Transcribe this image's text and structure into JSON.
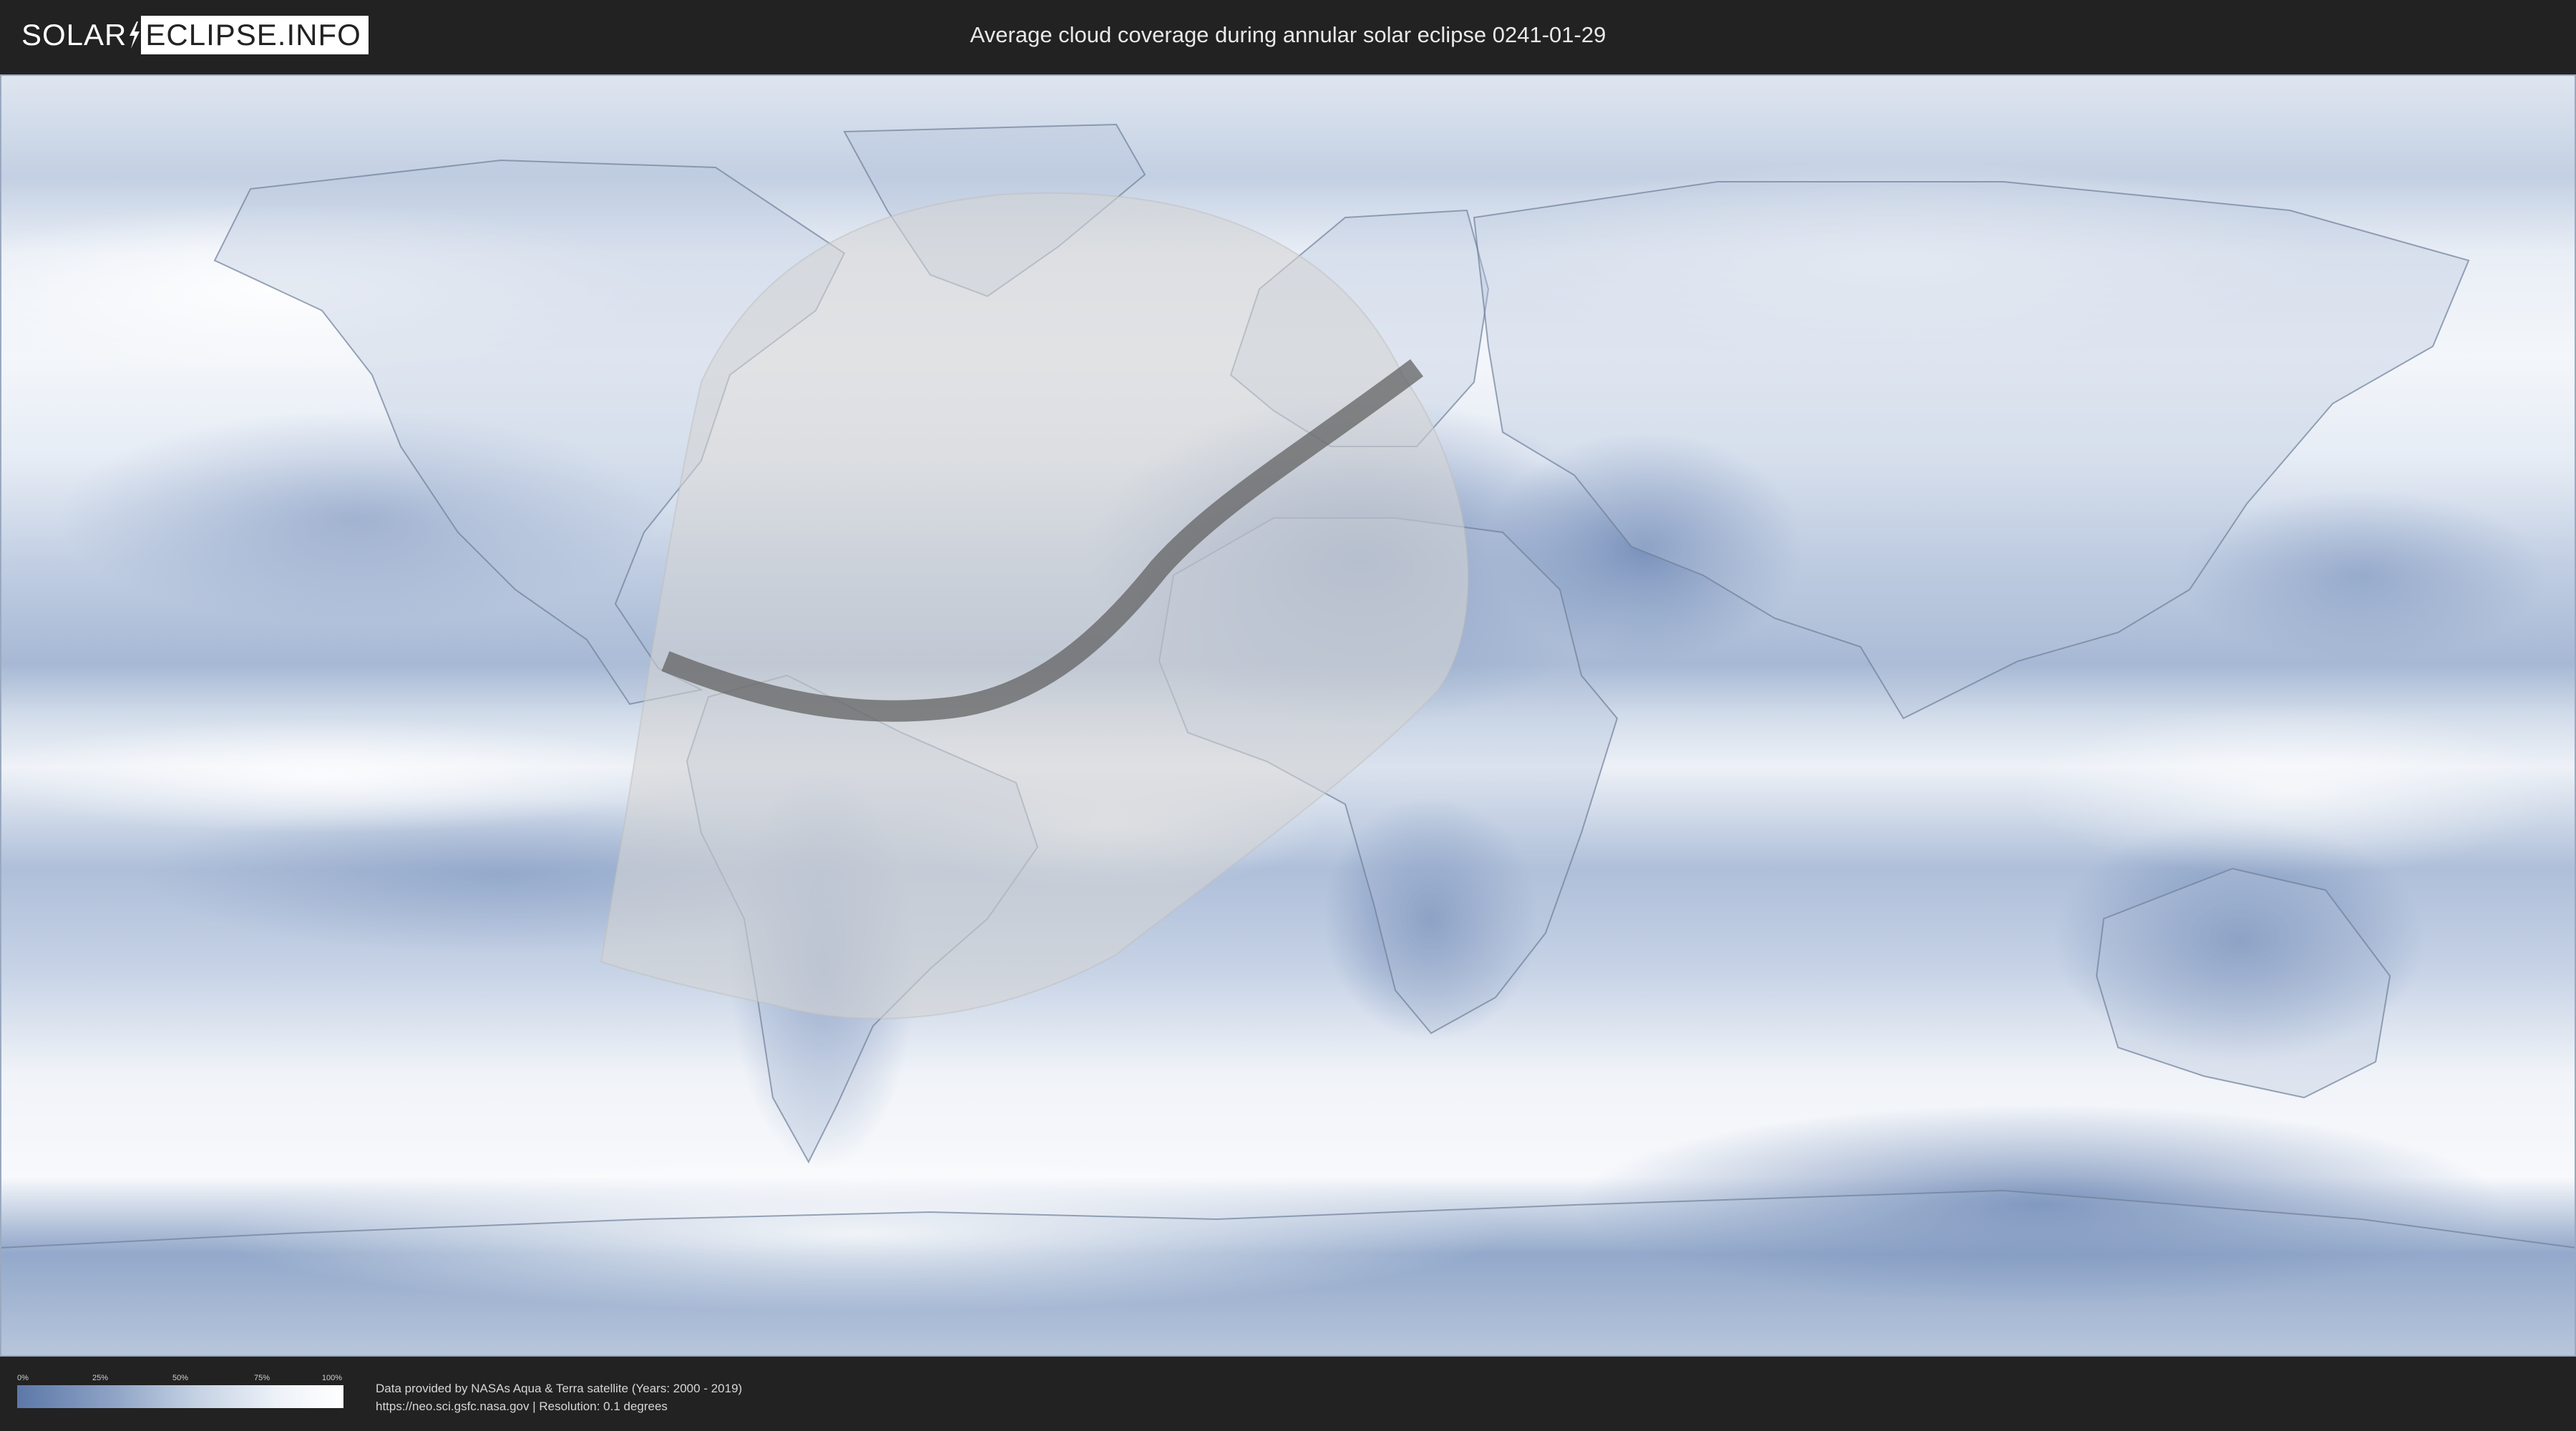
{
  "header": {
    "logo_left": "SOLAR",
    "logo_right": "ECLIPSE.INFO",
    "title": "Average cloud coverage during annular solar eclipse 0241-01-29"
  },
  "map": {
    "projection": "equirectangular",
    "layers": [
      "cloud-coverage",
      "country-borders",
      "eclipse-visibility-zone",
      "annularity-path"
    ],
    "colors": {
      "ocean_cloud_dark": "#7d95bf",
      "cloud_clear": "#f4f7fb",
      "visibility_zone": "#cfcfcf",
      "annular_path": "#5e5e5e"
    }
  },
  "legend": {
    "ticks": [
      "0%",
      "25%",
      "50%",
      "75%",
      "100%"
    ],
    "gradient_from": "#5c78a8",
    "gradient_to": "#ffffff"
  },
  "credits": {
    "line1": "Data provided by NASAs Aqua & Terra satellite (Years: 2000 - 2019)",
    "line2": "https://neo.sci.gsfc.nasa.gov | Resolution: 0.1 degrees"
  }
}
